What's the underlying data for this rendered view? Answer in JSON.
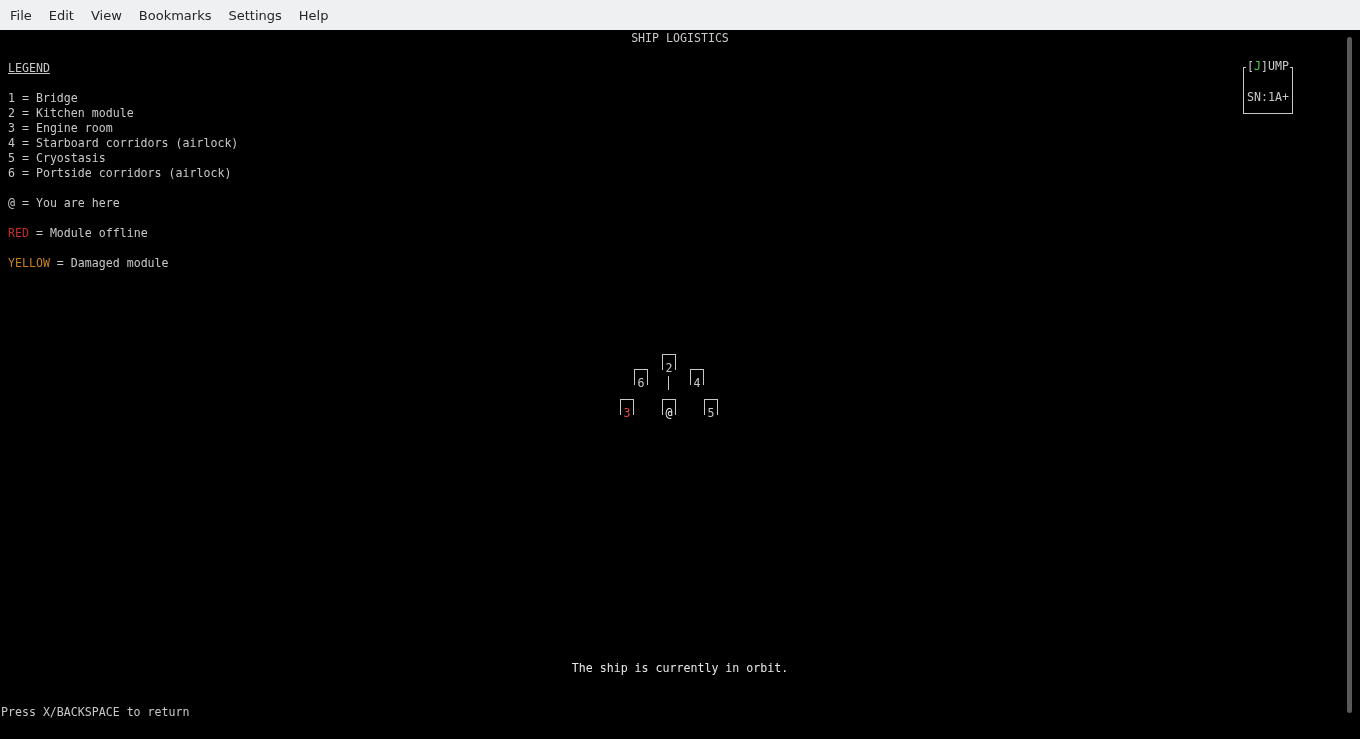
{
  "menu": [
    "File",
    "Edit",
    "View",
    "Bookmarks",
    "Settings",
    "Help"
  ],
  "title": "SHIP LOGISTICS",
  "legend": {
    "heading": "LEGEND",
    "modules": [
      "1 = Bridge",
      "2 = Kitchen module",
      "3 = Engine room",
      "4 = Starboard corridors (airlock)",
      "5 = Cryostasis",
      "6 = Portside corridors (airlock)"
    ],
    "here": "@ = You are here",
    "statuses": [
      {
        "term": "RED",
        "text": " = Module offline",
        "color": "#c42b2b"
      },
      {
        "term": "YELLOW",
        "text": " = Damaged module",
        "color": "#c8801e"
      }
    ]
  },
  "jump": {
    "prefix": "[",
    "key": "J",
    "suffix": "]UMP",
    "serial": "SN:1A+"
  },
  "map": [
    {
      "label": "2",
      "kind": "module",
      "offline": false
    },
    {
      "label": "6",
      "kind": "module",
      "offline": false
    },
    {
      "label": "4",
      "kind": "module",
      "offline": false
    },
    {
      "label": "3",
      "kind": "module",
      "offline": true
    },
    {
      "label": "@",
      "kind": "player",
      "offline": false
    },
    {
      "label": "5",
      "kind": "module",
      "offline": false
    }
  ],
  "status": "The ship is currently in orbit.",
  "prompt": "Press X/BACKSPACE to return"
}
